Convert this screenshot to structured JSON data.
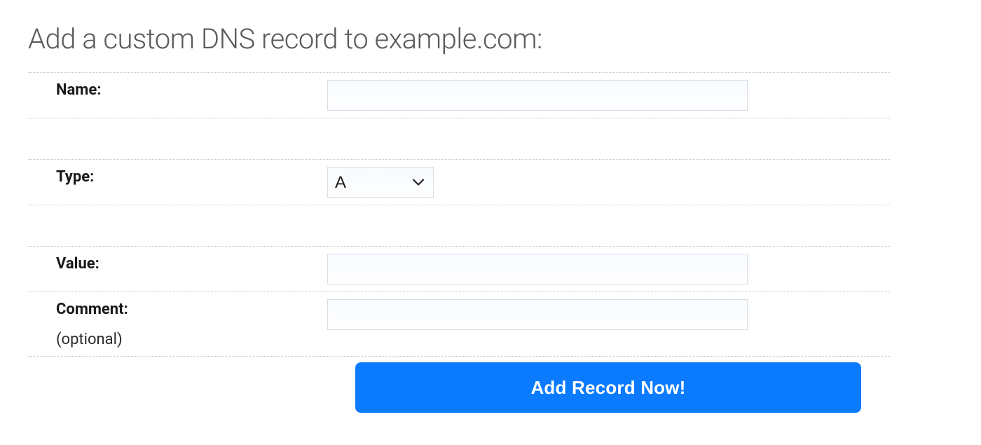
{
  "page_title": "Add a custom DNS record to example.com:",
  "form": {
    "name": {
      "label": "Name:",
      "value": ""
    },
    "type": {
      "label": "Type:",
      "selected": "A"
    },
    "value": {
      "label": "Value:",
      "value": ""
    },
    "comment": {
      "label": "Comment:",
      "sub_label": "(optional)",
      "value": ""
    },
    "submit_label": "Add Record Now!"
  }
}
